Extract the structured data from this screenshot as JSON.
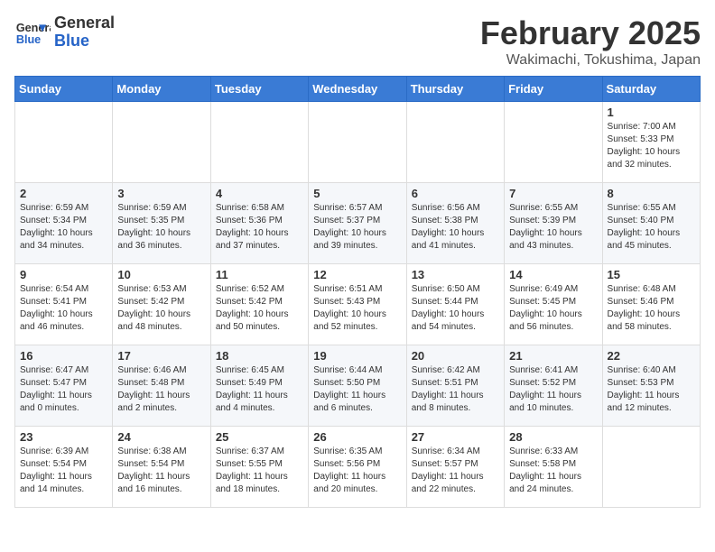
{
  "header": {
    "logo_general": "General",
    "logo_blue": "Blue",
    "month_title": "February 2025",
    "location": "Wakimachi, Tokushima, Japan"
  },
  "weekdays": [
    "Sunday",
    "Monday",
    "Tuesday",
    "Wednesday",
    "Thursday",
    "Friday",
    "Saturday"
  ],
  "weeks": [
    [
      {
        "day": "",
        "info": ""
      },
      {
        "day": "",
        "info": ""
      },
      {
        "day": "",
        "info": ""
      },
      {
        "day": "",
        "info": ""
      },
      {
        "day": "",
        "info": ""
      },
      {
        "day": "",
        "info": ""
      },
      {
        "day": "1",
        "info": "Sunrise: 7:00 AM\nSunset: 5:33 PM\nDaylight: 10 hours and 32 minutes."
      }
    ],
    [
      {
        "day": "2",
        "info": "Sunrise: 6:59 AM\nSunset: 5:34 PM\nDaylight: 10 hours and 34 minutes."
      },
      {
        "day": "3",
        "info": "Sunrise: 6:59 AM\nSunset: 5:35 PM\nDaylight: 10 hours and 36 minutes."
      },
      {
        "day": "4",
        "info": "Sunrise: 6:58 AM\nSunset: 5:36 PM\nDaylight: 10 hours and 37 minutes."
      },
      {
        "day": "5",
        "info": "Sunrise: 6:57 AM\nSunset: 5:37 PM\nDaylight: 10 hours and 39 minutes."
      },
      {
        "day": "6",
        "info": "Sunrise: 6:56 AM\nSunset: 5:38 PM\nDaylight: 10 hours and 41 minutes."
      },
      {
        "day": "7",
        "info": "Sunrise: 6:55 AM\nSunset: 5:39 PM\nDaylight: 10 hours and 43 minutes."
      },
      {
        "day": "8",
        "info": "Sunrise: 6:55 AM\nSunset: 5:40 PM\nDaylight: 10 hours and 45 minutes."
      }
    ],
    [
      {
        "day": "9",
        "info": "Sunrise: 6:54 AM\nSunset: 5:41 PM\nDaylight: 10 hours and 46 minutes."
      },
      {
        "day": "10",
        "info": "Sunrise: 6:53 AM\nSunset: 5:42 PM\nDaylight: 10 hours and 48 minutes."
      },
      {
        "day": "11",
        "info": "Sunrise: 6:52 AM\nSunset: 5:42 PM\nDaylight: 10 hours and 50 minutes."
      },
      {
        "day": "12",
        "info": "Sunrise: 6:51 AM\nSunset: 5:43 PM\nDaylight: 10 hours and 52 minutes."
      },
      {
        "day": "13",
        "info": "Sunrise: 6:50 AM\nSunset: 5:44 PM\nDaylight: 10 hours and 54 minutes."
      },
      {
        "day": "14",
        "info": "Sunrise: 6:49 AM\nSunset: 5:45 PM\nDaylight: 10 hours and 56 minutes."
      },
      {
        "day": "15",
        "info": "Sunrise: 6:48 AM\nSunset: 5:46 PM\nDaylight: 10 hours and 58 minutes."
      }
    ],
    [
      {
        "day": "16",
        "info": "Sunrise: 6:47 AM\nSunset: 5:47 PM\nDaylight: 11 hours and 0 minutes."
      },
      {
        "day": "17",
        "info": "Sunrise: 6:46 AM\nSunset: 5:48 PM\nDaylight: 11 hours and 2 minutes."
      },
      {
        "day": "18",
        "info": "Sunrise: 6:45 AM\nSunset: 5:49 PM\nDaylight: 11 hours and 4 minutes."
      },
      {
        "day": "19",
        "info": "Sunrise: 6:44 AM\nSunset: 5:50 PM\nDaylight: 11 hours and 6 minutes."
      },
      {
        "day": "20",
        "info": "Sunrise: 6:42 AM\nSunset: 5:51 PM\nDaylight: 11 hours and 8 minutes."
      },
      {
        "day": "21",
        "info": "Sunrise: 6:41 AM\nSunset: 5:52 PM\nDaylight: 11 hours and 10 minutes."
      },
      {
        "day": "22",
        "info": "Sunrise: 6:40 AM\nSunset: 5:53 PM\nDaylight: 11 hours and 12 minutes."
      }
    ],
    [
      {
        "day": "23",
        "info": "Sunrise: 6:39 AM\nSunset: 5:54 PM\nDaylight: 11 hours and 14 minutes."
      },
      {
        "day": "24",
        "info": "Sunrise: 6:38 AM\nSunset: 5:54 PM\nDaylight: 11 hours and 16 minutes."
      },
      {
        "day": "25",
        "info": "Sunrise: 6:37 AM\nSunset: 5:55 PM\nDaylight: 11 hours and 18 minutes."
      },
      {
        "day": "26",
        "info": "Sunrise: 6:35 AM\nSunset: 5:56 PM\nDaylight: 11 hours and 20 minutes."
      },
      {
        "day": "27",
        "info": "Sunrise: 6:34 AM\nSunset: 5:57 PM\nDaylight: 11 hours and 22 minutes."
      },
      {
        "day": "28",
        "info": "Sunrise: 6:33 AM\nSunset: 5:58 PM\nDaylight: 11 hours and 24 minutes."
      },
      {
        "day": "",
        "info": ""
      }
    ]
  ]
}
